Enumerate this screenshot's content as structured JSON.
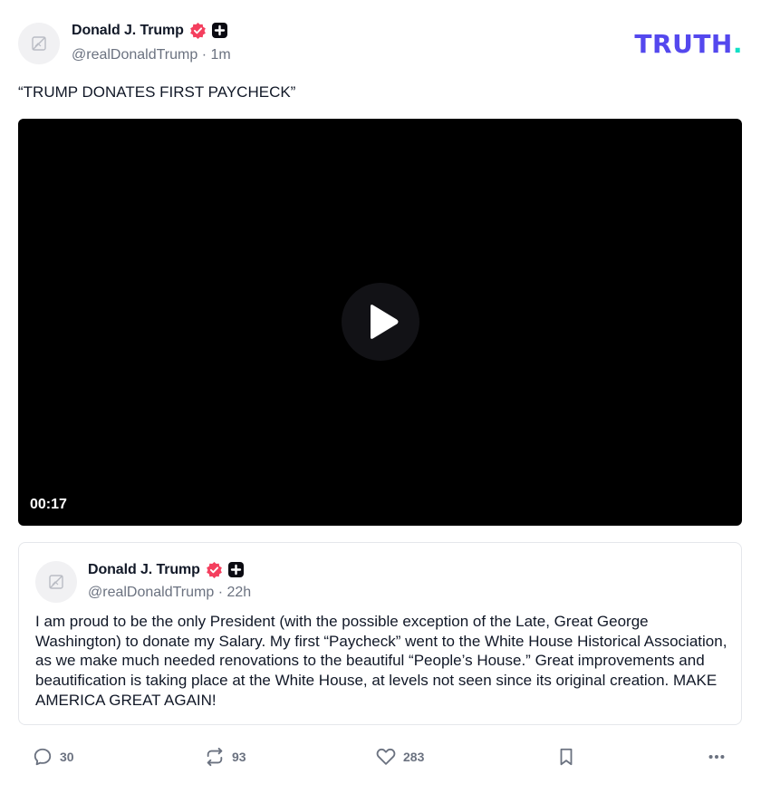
{
  "post": {
    "author": {
      "name": "Donald J. Trump",
      "handle": "@realDonaldTrump",
      "separator": "·",
      "time": "1m"
    },
    "logo": {
      "text": "TRUTH",
      "dot": "."
    },
    "text": "“TRUMP DONATES FIRST PAYCHECK”",
    "video": {
      "duration": "00:17"
    }
  },
  "quote": {
    "author": {
      "name": "Donald J. Trump",
      "handle": "@realDonaldTrump",
      "separator": "·",
      "time": "22h"
    },
    "text": "I am proud to be the only President (with the possible exception of the Late, Great George Washington) to donate my Salary. My first “Paycheck” went to the White House Historical Association, as we make much needed renovations to the beautiful “People’s House.” Great improvements and beautification is taking place at the White House, at levels not seen since its original creation. MAKE AMERICA GREAT AGAIN!"
  },
  "actions": {
    "replies": "30",
    "retruths": "93",
    "likes": "283"
  },
  "colors": {
    "brand": "#5448ee",
    "brand_accent": "#11e0c6",
    "verified": "#f43f5e",
    "muted": "#6b7280"
  },
  "icons": [
    "image-placeholder-icon",
    "verified-badge-icon",
    "plus-badge-icon",
    "play-icon",
    "reply-icon",
    "retruth-icon",
    "heart-icon",
    "bookmark-icon",
    "more-icon"
  ]
}
